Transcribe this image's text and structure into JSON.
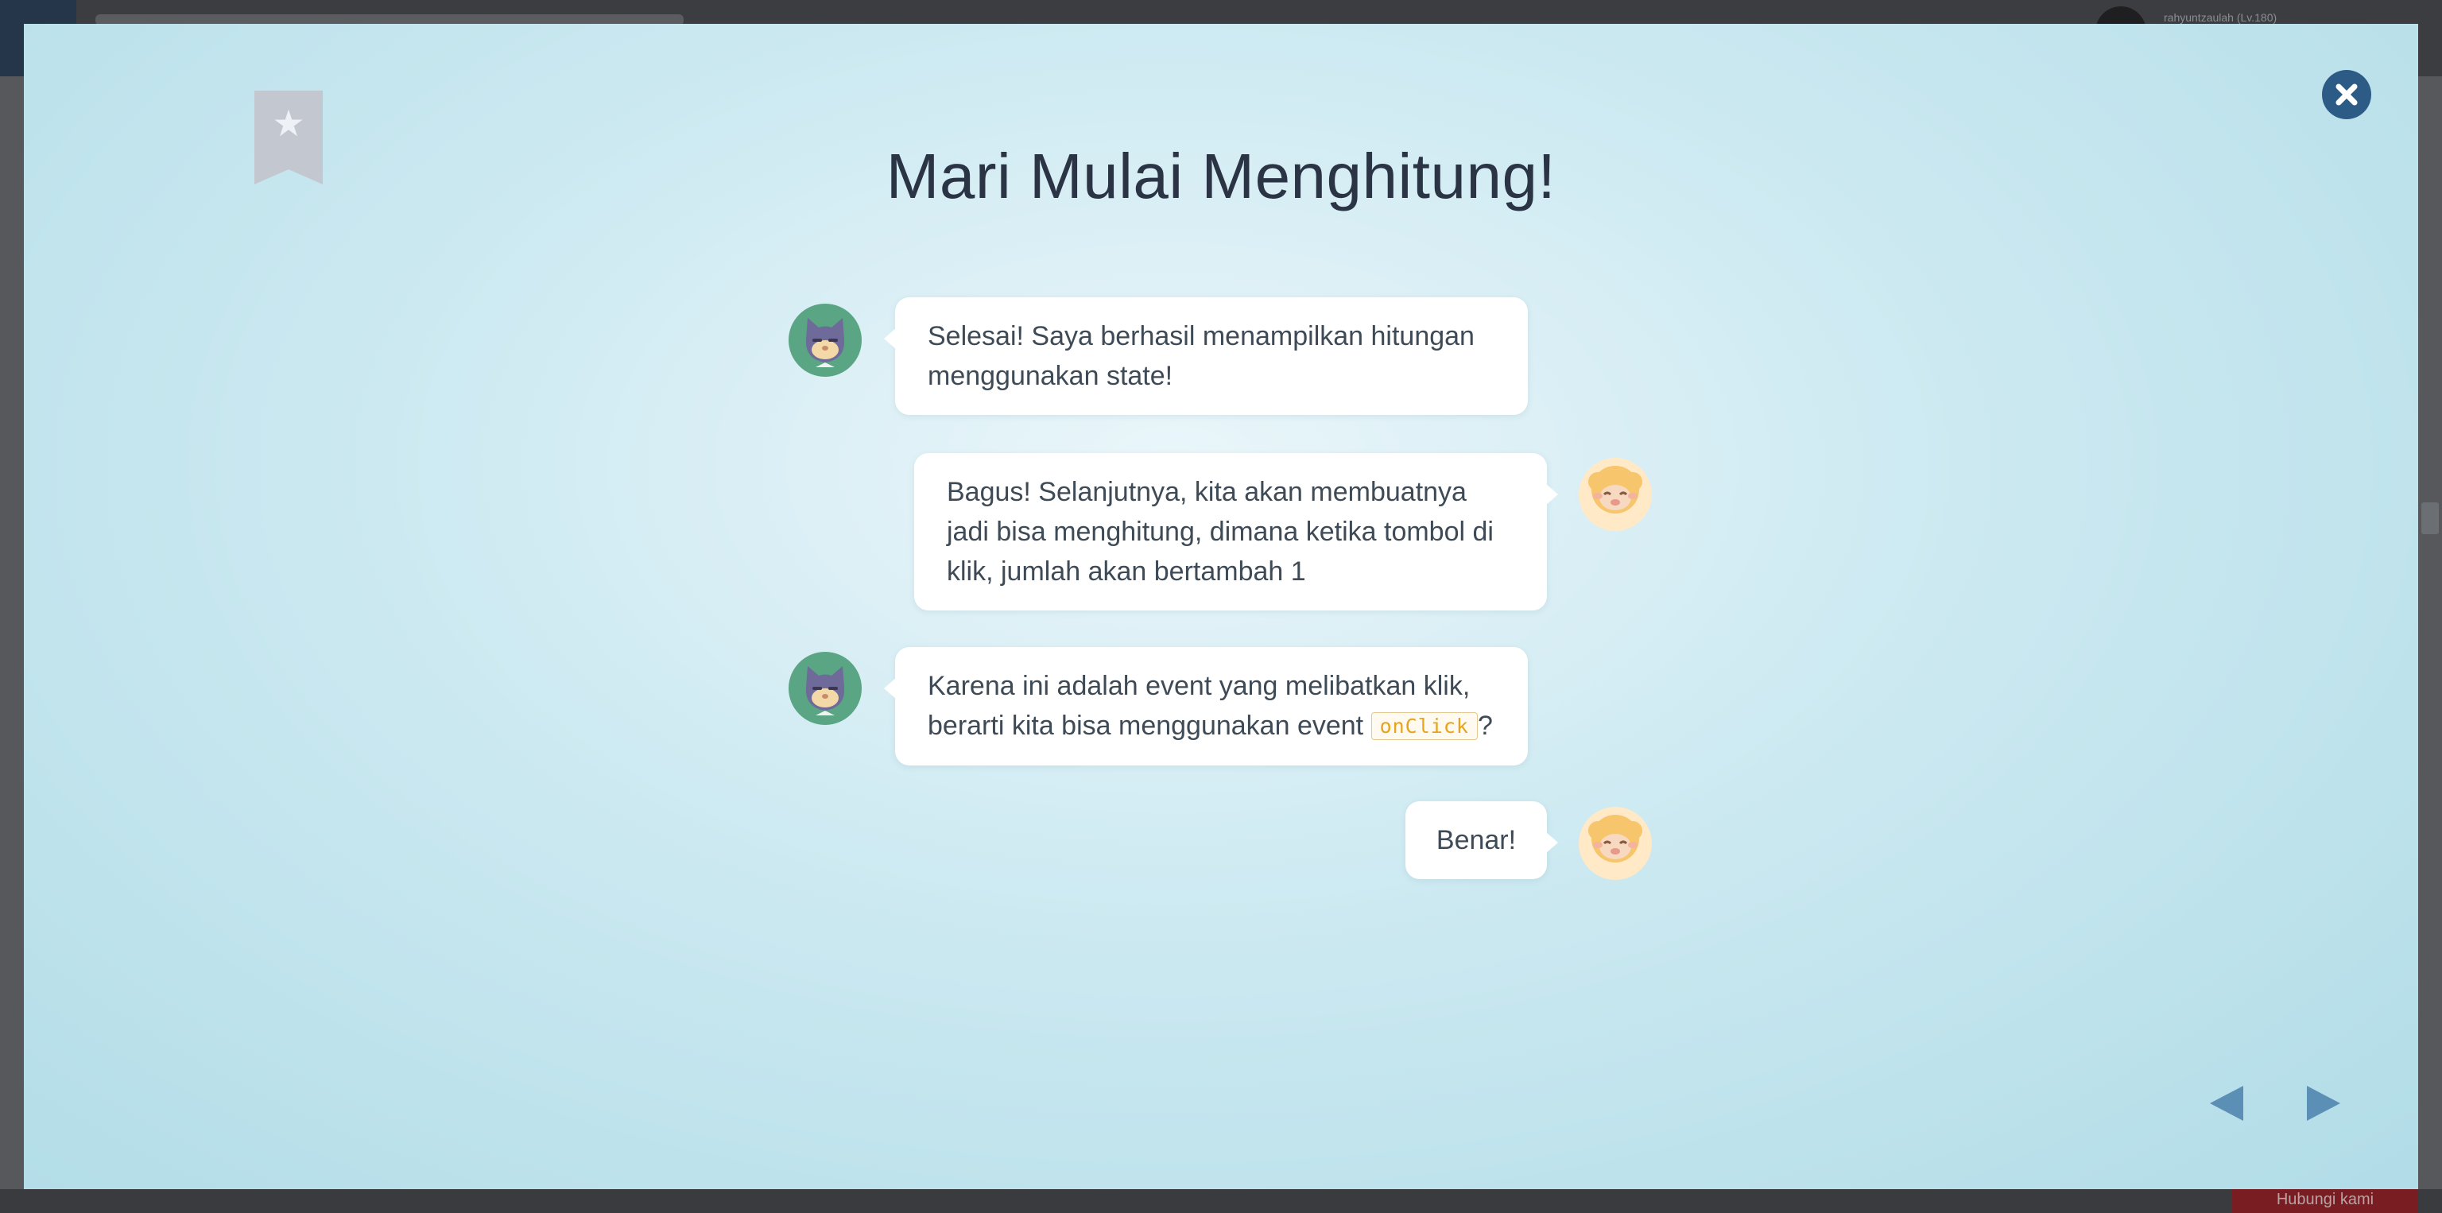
{
  "background": {
    "username": "rahyuntzaulah (Lv.180)",
    "bottom_button_label": "Hubungi kami"
  },
  "modal": {
    "title": "Mari Mulai Menghitung!",
    "icons": {
      "bookmark": "bookmark-star-icon",
      "close": "close-icon",
      "prev": "triangle-left-icon",
      "next": "triangle-right-icon"
    },
    "messages": [
      {
        "speaker": "cat",
        "side": "left",
        "text": "Selesai! Saya berhasil menampilkan hitungan menggunakan state!"
      },
      {
        "speaker": "sheep",
        "side": "right",
        "text": "Bagus! Selanjutnya, kita akan membuatnya jadi bisa menghitung, dimana ketika tombol di klik, jumlah akan bertambah 1"
      },
      {
        "speaker": "cat",
        "side": "left",
        "text_before": "Karena ini adalah event yang melibatkan klik, berarti kita bisa menggunakan event",
        "code": "onClick",
        "text_after": "?"
      },
      {
        "speaker": "sheep",
        "side": "right",
        "text": "Benar!"
      }
    ],
    "colors": {
      "close_button": "#2c5c85",
      "nav_arrow": "#5b8fb5",
      "code_text": "#e8a31c",
      "cat_avatar_bg": "#5aa583",
      "sheep_avatar_bg": "#ffe9c6"
    }
  }
}
